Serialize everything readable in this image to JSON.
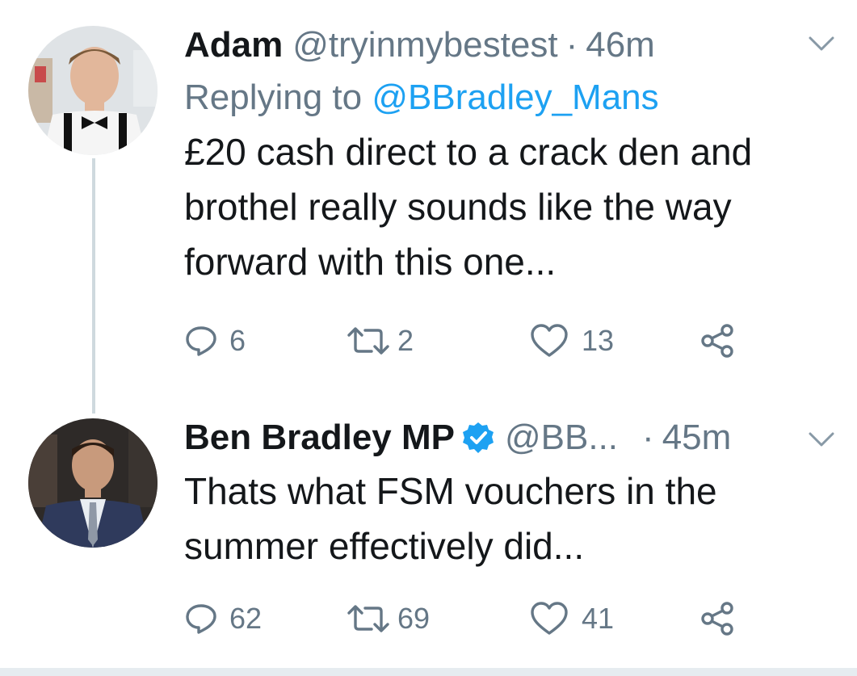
{
  "tweets": [
    {
      "name": "Adam",
      "handle": "@tryinmybestest",
      "separator": "·",
      "time": "46m",
      "reply_prefix": "Replying to",
      "reply_handle": "@BBradley_Mans",
      "text": "£20 cash direct to a crack den and brothel really sounds like the way forward with this one...",
      "replies": "6",
      "retweets": "2",
      "likes": "13",
      "icons": [
        "reply-icon",
        "retweet-icon",
        "like-icon",
        "share-icon",
        "chevron-down-icon"
      ]
    },
    {
      "name": "Ben Bradley MP",
      "verified": true,
      "handle": "@BB...",
      "separator": "·",
      "time": "45m",
      "text": "Thats what FSM vouchers in the summer effectively did...",
      "replies": "62",
      "retweets": "69",
      "likes": "41",
      "icons": [
        "reply-icon",
        "retweet-icon",
        "like-icon",
        "share-icon",
        "chevron-down-icon",
        "verified-badge-icon"
      ]
    }
  ],
  "colors": {
    "link": "#1da1f2",
    "secondary_text": "#657786",
    "primary_text": "#14171a",
    "thread_line": "#cfd9de",
    "verified": "#1da1f2"
  }
}
